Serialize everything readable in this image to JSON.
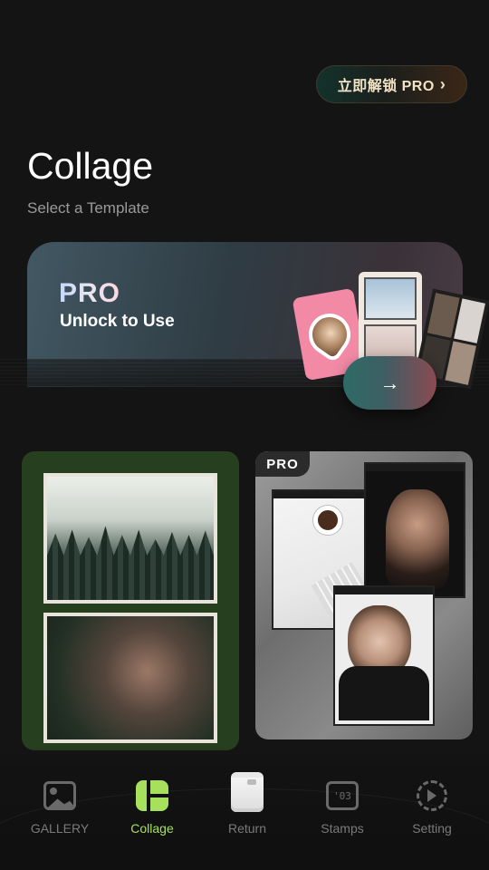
{
  "header": {
    "unlock_button_label": "立即解锁 PRO",
    "title": "Collage",
    "subtitle": "Select a Template"
  },
  "banner": {
    "badge": "PRO",
    "text": "Unlock to Use"
  },
  "templates": {
    "card2_badge": "PRO"
  },
  "nav": {
    "items": [
      {
        "label": "GALLERY",
        "icon": "gallery-icon",
        "active": false
      },
      {
        "label": "Collage",
        "icon": "collage-icon",
        "active": true
      },
      {
        "label": "Return",
        "icon": "camera-return-icon",
        "active": false
      },
      {
        "label": "Stamps",
        "icon": "stamp-icon",
        "active": false
      },
      {
        "label": "Setting",
        "icon": "gear-icon",
        "active": false
      }
    ]
  },
  "colors": {
    "accent": "#a6e05c",
    "background": "#141414",
    "inactive": "#7a7a7a"
  },
  "icons": {
    "stamp_glyph": "'03",
    "arrow_glyph": "→",
    "chevron_glyph": "›"
  }
}
